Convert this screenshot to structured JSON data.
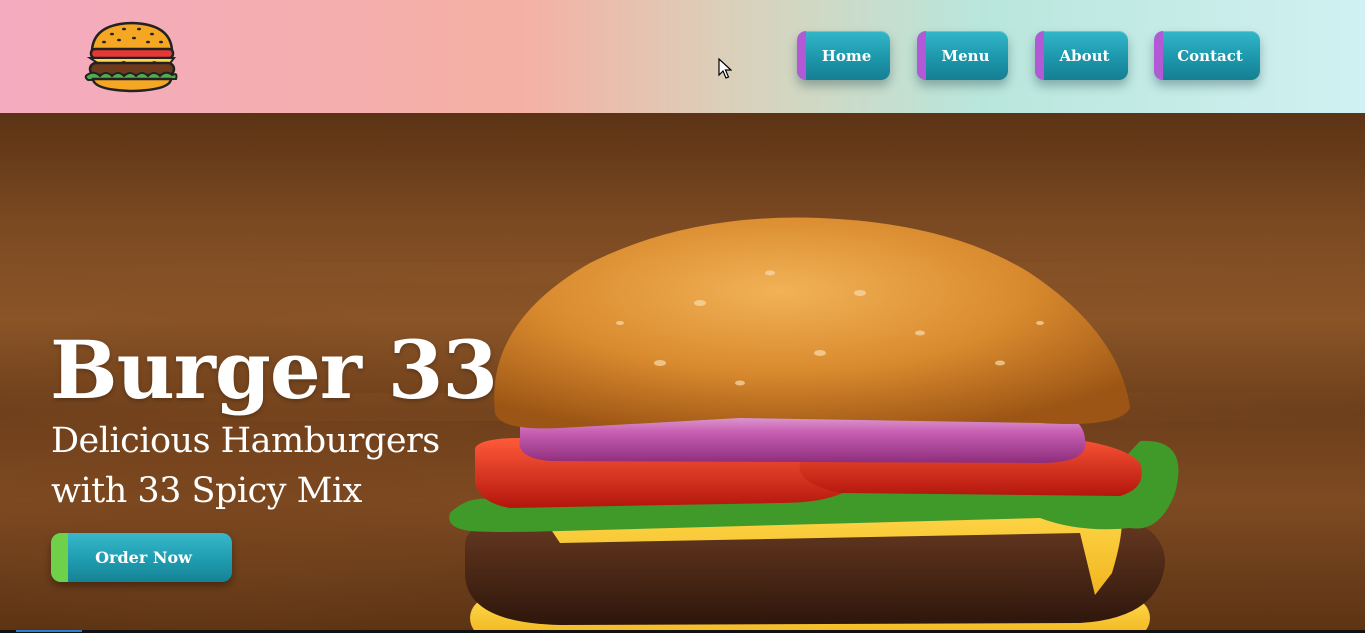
{
  "header": {
    "logo_icon": "burger-logo-icon",
    "nav": [
      {
        "label": "Home"
      },
      {
        "label": "Menu"
      },
      {
        "label": "About"
      },
      {
        "label": "Contact"
      }
    ]
  },
  "hero": {
    "title": "Burger 33",
    "subtitle_line1": "Delicious Hamburgers",
    "subtitle_line2": "with 33 Spicy Mix",
    "cta_label": "Order Now",
    "image": "burger-photo"
  },
  "colors": {
    "nav_button": "#1d97ab",
    "nav_accent": "#b25ad6",
    "cta_accent": "#6fd14a",
    "text": "#ffffff"
  }
}
